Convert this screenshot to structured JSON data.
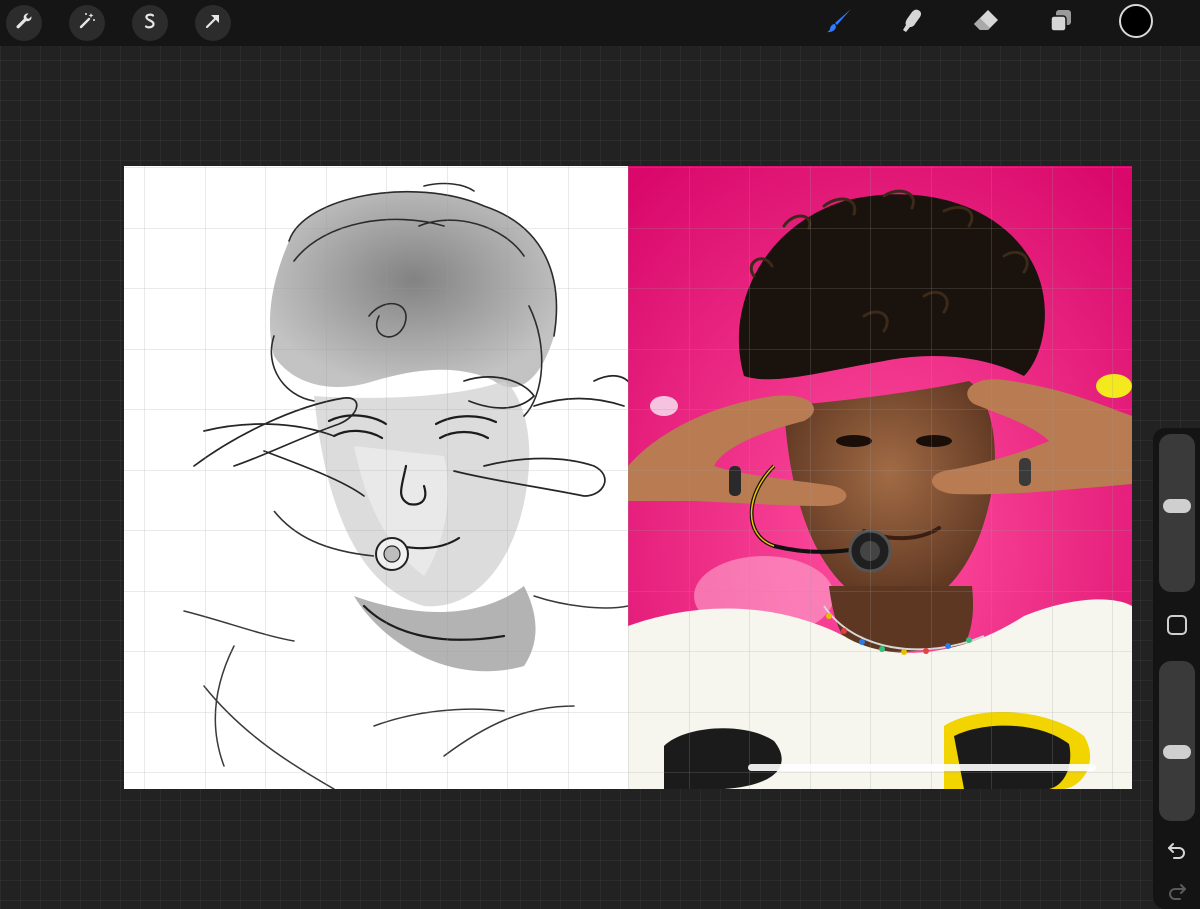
{
  "toolbar": {
    "left_tools": [
      {
        "name": "actions",
        "icon": "wrench-icon"
      },
      {
        "name": "adjustments",
        "icon": "magic-wand-icon"
      },
      {
        "name": "selection",
        "icon": "selection-s-icon"
      },
      {
        "name": "transform",
        "icon": "arrow-cursor-icon"
      }
    ],
    "right_tools": [
      {
        "name": "brush",
        "icon": "brush-icon",
        "active": true
      },
      {
        "name": "smudge",
        "icon": "smudge-finger-icon"
      },
      {
        "name": "eraser",
        "icon": "eraser-icon"
      },
      {
        "name": "layers",
        "icon": "layers-icon"
      }
    ],
    "active_color": "#000000",
    "accent_color": "#2f7dff"
  },
  "canvas": {
    "reference_background": "#e0136e",
    "sketch_background": "#ffffff"
  },
  "side_panel": {
    "brush_size_level": 0.55,
    "brush_opacity_level": 0.42,
    "undo_icon": "undo-icon",
    "redo_icon": "redo-icon"
  }
}
